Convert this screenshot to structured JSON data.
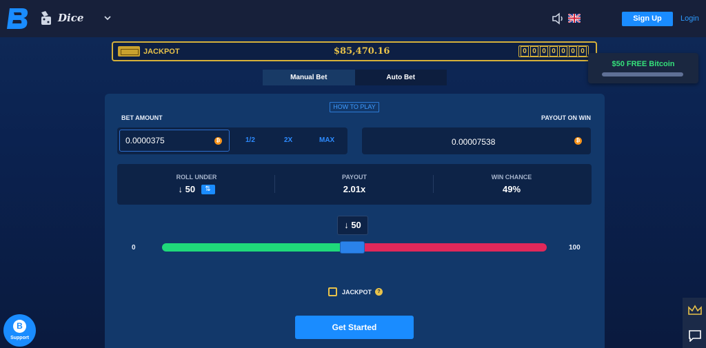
{
  "header": {
    "game_name": "Dice",
    "signup_label": "Sign Up",
    "login_label": "Login"
  },
  "jackpot": {
    "label": "JACKPOT",
    "amount": "$85,470.16",
    "digits": [
      "0",
      "0",
      "0",
      "0",
      "0",
      "0",
      "0"
    ]
  },
  "promo": {
    "text": "$50 FREE Bitcoin"
  },
  "tabs": [
    {
      "label": "Manual Bet",
      "active": true
    },
    {
      "label": "Auto Bet",
      "active": false
    }
  ],
  "panel": {
    "how_to_play": "HOW TO PLAY",
    "bet_amount_label": "BET AMOUNT",
    "bet_amount_value": "0.0000375",
    "bet_options": {
      "half": "1/2",
      "double": "2X",
      "max": "MAX"
    },
    "payout_label": "PAYOUT ON WIN",
    "payout_value": "0.00007538",
    "currency_icon": "bitcoin-icon",
    "stats": {
      "roll_under_label": "ROLL UNDER",
      "roll_under_value": "↓ 50",
      "payout_label": "PAYOUT",
      "payout_value": "2.01x",
      "win_chance_label": "WIN CHANCE",
      "win_chance_value": "49%"
    },
    "slider": {
      "bubble": "↓ 50",
      "min_label": "0",
      "max_label": "100",
      "value": 50
    },
    "jackpot_checkbox_label": "JACKPOT",
    "jackpot_help": "?",
    "start_button": "Get Started"
  },
  "support": {
    "label": "Support"
  },
  "colors": {
    "accent": "#1a8cff",
    "gold": "#e8c24a",
    "win_green": "#1fd97a",
    "lose_red": "#e0285a",
    "promo_green": "#35e07a"
  }
}
